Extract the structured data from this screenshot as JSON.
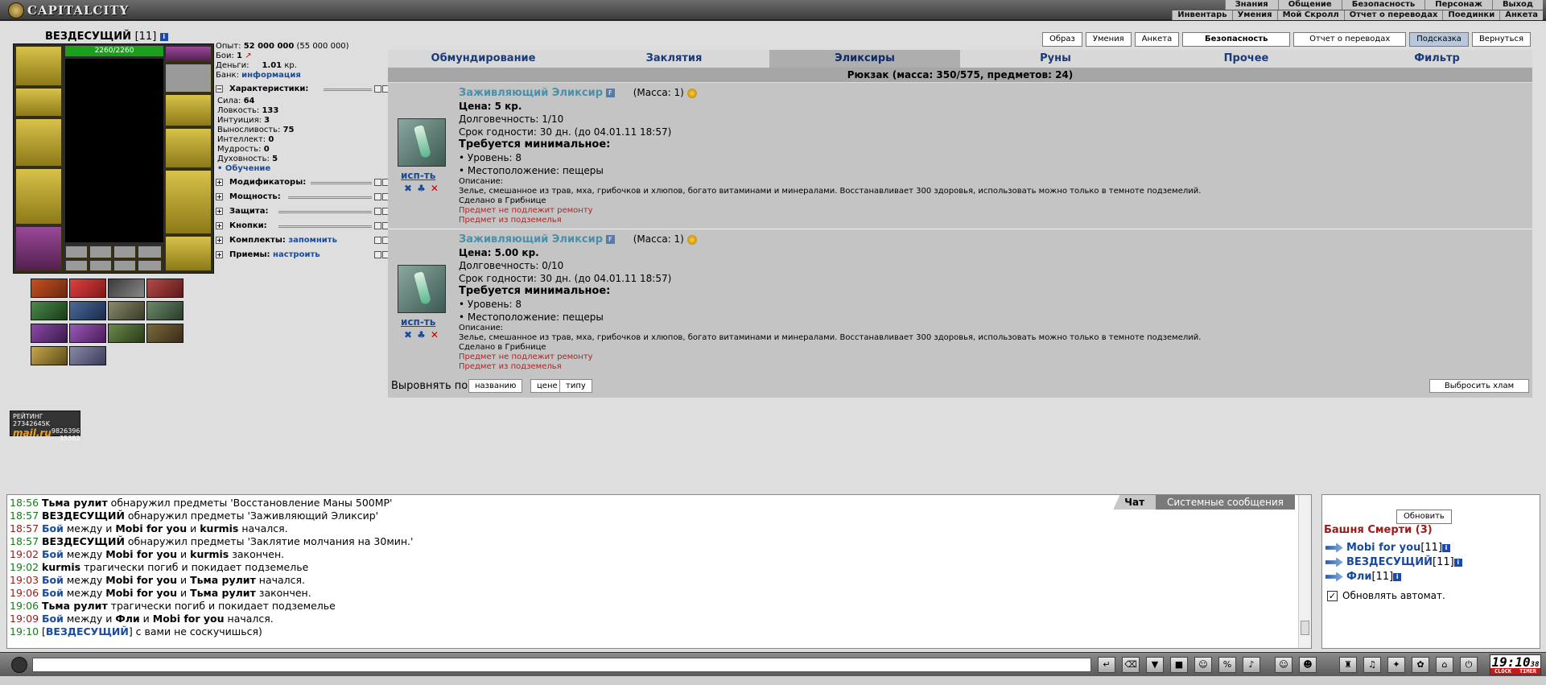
{
  "app": {
    "logo_text": "CAPITALCITY"
  },
  "menu_top": [
    "Знания",
    "Общение",
    "Безопасность",
    "Персонаж",
    "Выход"
  ],
  "menu_sub": [
    "Инвентарь",
    "Умения",
    "Мой Скролл",
    "Отчет о переводах",
    "Поединки",
    "Анкета"
  ],
  "player": {
    "name": "ВЕЗДЕСУЩИЙ",
    "level": "[11]",
    "hp": "2260/2260",
    "exp_label": "Опыт:",
    "exp": "52 000 000",
    "exp_next": "(55 000 000)",
    "battles_label": "Бои:",
    "battles": "1",
    "money_label": "Деньги:",
    "money": "1.01",
    "money_unit": "кр.",
    "bank_label": "Банк:",
    "bank_link": "информация"
  },
  "stats": {
    "header": "Характеристики:",
    "items": [
      {
        "label": "Сила:",
        "value": "64"
      },
      {
        "label": "Ловкость:",
        "value": "133"
      },
      {
        "label": "Интуиция:",
        "value": "3"
      },
      {
        "label": "Выносливость:",
        "value": "75"
      },
      {
        "label": "Интеллект:",
        "value": "0"
      },
      {
        "label": "Мудрость:",
        "value": "0"
      },
      {
        "label": "Духовность:",
        "value": "5"
      }
    ],
    "training": "• Обучение"
  },
  "sections": [
    {
      "label": "Модификаторы:",
      "extra": ""
    },
    {
      "label": "Мощность:",
      "extra": ""
    },
    {
      "label": "Защита:",
      "extra": ""
    },
    {
      "label": "Кнопки:",
      "extra": ""
    },
    {
      "label": "Комплекты:",
      "extra": "запомнить"
    },
    {
      "label": "Приемы:",
      "extra": "настроить"
    }
  ],
  "rating": {
    "label": "РЕЙТИНГ",
    "value": "27342645K",
    "brand": "mail.ru",
    "n1": "9826396",
    "n2": "35382"
  },
  "buttons": [
    "Образ",
    "Умения",
    "Анкета",
    "Безопасность",
    "Отчет о переводах",
    "Подсказка",
    "Вернуться"
  ],
  "tabs": [
    "Обмундирование",
    "Заклятия",
    "Эликсиры",
    "Руны",
    "Прочее",
    "Фильтр"
  ],
  "active_tab": "Эликсиры",
  "backpack": "Рюкзак (масса: 350/575, предметов: 24)",
  "items": [
    {
      "name": "Заживляющий Эликсир",
      "badge": "F",
      "mass": "(Масса: 1)",
      "price": "Цена: 5 кр.",
      "durability": "Долговечность: 1/10",
      "expiry": "Срок годности: 30 дн. (до 04.01.11 18:57)",
      "req_title": "Требуется минимальное:",
      "req_level": "• Уровень: 8",
      "req_loc": "• Местоположение: пещеры",
      "desc_label": "Описание:",
      "desc": "Зелье, смешанное из трав, мха, грибочков и хлюпов, богато витаминами и минералами. Восстанавливает 300 здоровья, использовать можно только в темноте подземелий.",
      "made": "Сделано в Грибнице",
      "note1": "Предмет не подлежит ремонту",
      "note2": "Предмет из подземелья",
      "use": "исп-ть"
    },
    {
      "name": "Заживляющий Эликсир",
      "badge": "F",
      "mass": "(Масса: 1)",
      "price": "Цена: 5.00 кр.",
      "durability": "Долговечность: 0/10",
      "expiry": "Срок годности: 30 дн. (до 04.01.11 18:57)",
      "req_title": "Требуется минимальное:",
      "req_level": "• Уровень: 8",
      "req_loc": "• Местоположение: пещеры",
      "desc_label": "Описание:",
      "desc": "Зелье, смешанное из трав, мха, грибочков и хлюпов, богато витаминами и минералами. Восстанавливает 300 здоровья, использовать можно только в темноте подземелий.",
      "made": "Сделано в Грибнице",
      "note1": "Предмет не подлежит ремонту",
      "note2": "Предмет из подземелья",
      "use": "исп-ть"
    }
  ],
  "sort": {
    "label": "Выровнять по",
    "options": [
      "названию",
      "цене",
      "типу"
    ],
    "trash": "Выбросить хлам"
  },
  "chat": {
    "tabs": [
      "Чат",
      "Системные сообщения"
    ],
    "lines": [
      {
        "t": "18:56",
        "r": false,
        "parts": [
          [
            "pl",
            "Тьма рулит"
          ],
          [
            "",
            " обнаружил предметы 'Восстановление Маны 500MP'"
          ]
        ]
      },
      {
        "t": "18:57",
        "r": false,
        "parts": [
          [
            "pl",
            "ВЕЗДЕСУЩИЙ"
          ],
          [
            "",
            " обнаружил предметы 'Заживляющий Эликсир'"
          ]
        ]
      },
      {
        "t": "18:57",
        "r": true,
        "parts": [
          [
            "boj",
            "Бой"
          ],
          [
            "",
            " между "
          ],
          [
            "",
            " и "
          ],
          [
            "pl",
            "Mobi for you"
          ],
          [
            "",
            " и "
          ],
          [
            "pl",
            "kurmis"
          ],
          [
            "",
            " начался."
          ]
        ]
      },
      {
        "t": "18:57",
        "r": false,
        "parts": [
          [
            "pl",
            "ВЕЗДЕСУЩИЙ"
          ],
          [
            "",
            " обнаружил предметы 'Заклятие молчания на 30мин.'"
          ]
        ]
      },
      {
        "t": "19:02",
        "r": true,
        "parts": [
          [
            "boj",
            "Бой"
          ],
          [
            "",
            " между "
          ],
          [
            "pl",
            "Mobi for you"
          ],
          [
            "",
            " и "
          ],
          [
            "pl",
            "kurmis"
          ],
          [
            "",
            " закончен."
          ]
        ]
      },
      {
        "t": "19:02",
        "r": false,
        "parts": [
          [
            "pl",
            "kurmis"
          ],
          [
            "",
            " трагически погиб и покидает подземелье"
          ]
        ]
      },
      {
        "t": "19:03",
        "r": true,
        "parts": [
          [
            "boj",
            "Бой"
          ],
          [
            "",
            " между "
          ],
          [
            "pl",
            "Mobi for you"
          ],
          [
            "",
            " и "
          ],
          [
            "pl",
            "Тьма рулит"
          ],
          [
            "",
            " начался."
          ]
        ]
      },
      {
        "t": "19:06",
        "r": true,
        "parts": [
          [
            "boj",
            "Бой"
          ],
          [
            "",
            " между "
          ],
          [
            "pl",
            "Mobi for you"
          ],
          [
            "",
            " и "
          ],
          [
            "pl",
            "Тьма рулит"
          ],
          [
            "",
            " закончен."
          ]
        ]
      },
      {
        "t": "19:06",
        "r": false,
        "parts": [
          [
            "pl",
            "Тьма рулит"
          ],
          [
            "",
            " трагически погиб и покидает подземелье"
          ]
        ]
      },
      {
        "t": "19:09",
        "r": true,
        "parts": [
          [
            "boj",
            "Бой"
          ],
          [
            "",
            " между "
          ],
          [
            "",
            " и "
          ],
          [
            "pl",
            "Фли"
          ],
          [
            "",
            " и "
          ],
          [
            "pl",
            "Mobi for you"
          ],
          [
            "",
            " начался."
          ]
        ]
      },
      {
        "t": "19:10",
        "r": false,
        "parts": [
          [
            "",
            "["
          ],
          [
            "me",
            "ВЕЗДЕСУЩИЙ"
          ],
          [
            "",
            "] с вами не соскучишься)"
          ]
        ]
      }
    ]
  },
  "online": {
    "refresh": "Обновить",
    "location": "Башня Смерти (3)",
    "users": [
      {
        "name": "Mobi for you",
        "level": "[11]"
      },
      {
        "name": "ВЕЗДЕСУЩИЙ",
        "level": "[11]"
      },
      {
        "name": "Фли",
        "level": "[11]"
      }
    ],
    "auto": "Обновлять автомат.",
    "auto_checked": true
  },
  "clock": {
    "time": "19:10",
    "sec": "38",
    "l1": "CLOCK",
    "l2": "TIMER"
  },
  "colors": {
    "tab_text": "#1a3a7a",
    "item_name": "#4a90a8",
    "red_note": "#b82020",
    "link": "#1a4a9a"
  }
}
